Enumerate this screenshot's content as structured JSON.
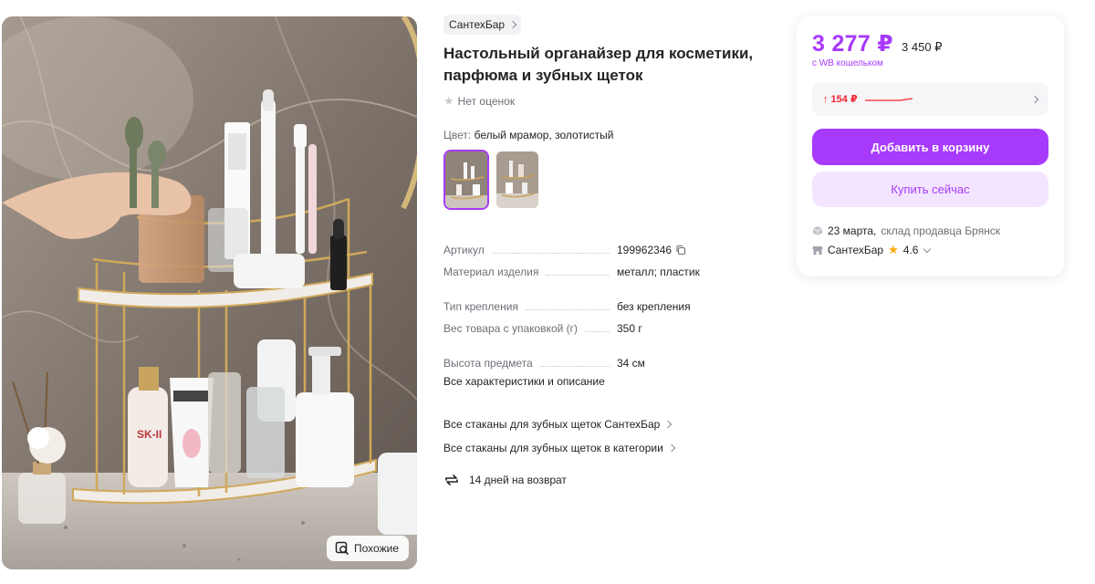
{
  "product": {
    "brand": "СантехБар",
    "title_line1": "Настольный органайзер для косметики,",
    "title_line2": "парфюма и зубных щеток",
    "rating_text": "Нет оценок",
    "color_label": "Цвет:",
    "color_value": "белый мрамор, золотистый",
    "similar_label": "Похожие"
  },
  "specs": [
    {
      "key": "Артикул",
      "value": "199962346"
    },
    {
      "key": "Материал изделия",
      "value": "металл; пластик"
    },
    {
      "key": "Тип крепления",
      "value": "без крепления"
    },
    {
      "key": "Вес товара с упаковкой (г)",
      "value": "350 г"
    },
    {
      "key": "Высота предмета",
      "value": "34 см"
    }
  ],
  "links": {
    "all_specs": "Все характеристики и описание",
    "brand_category": "Все стаканы для зубных щеток СантехБар",
    "category": "Все стаканы для зубных щеток в категории",
    "return_policy": "14 дней на возврат"
  },
  "buy_box": {
    "price": "3 277 ₽",
    "old_price": "3 450 ₽",
    "wallet_note": "с WB кошельком",
    "price_change": "↑ 154 ₽",
    "add_to_cart": "Добавить в корзину",
    "buy_now": "Купить сейчас",
    "delivery_date": "23 марта,",
    "delivery_from": "склад продавца Брянск",
    "seller_name": "СантехБар",
    "seller_rating": "4.6"
  },
  "colors": {
    "accent": "#a73afd",
    "accent_light": "#f3e5ff",
    "price_up": "#f5222d",
    "star": "#ffa800"
  },
  "icons": {
    "copy": "copy-icon",
    "return": "return-arrows-icon",
    "similar": "search-similar-icon",
    "box": "box-icon",
    "shop": "shop-icon"
  }
}
